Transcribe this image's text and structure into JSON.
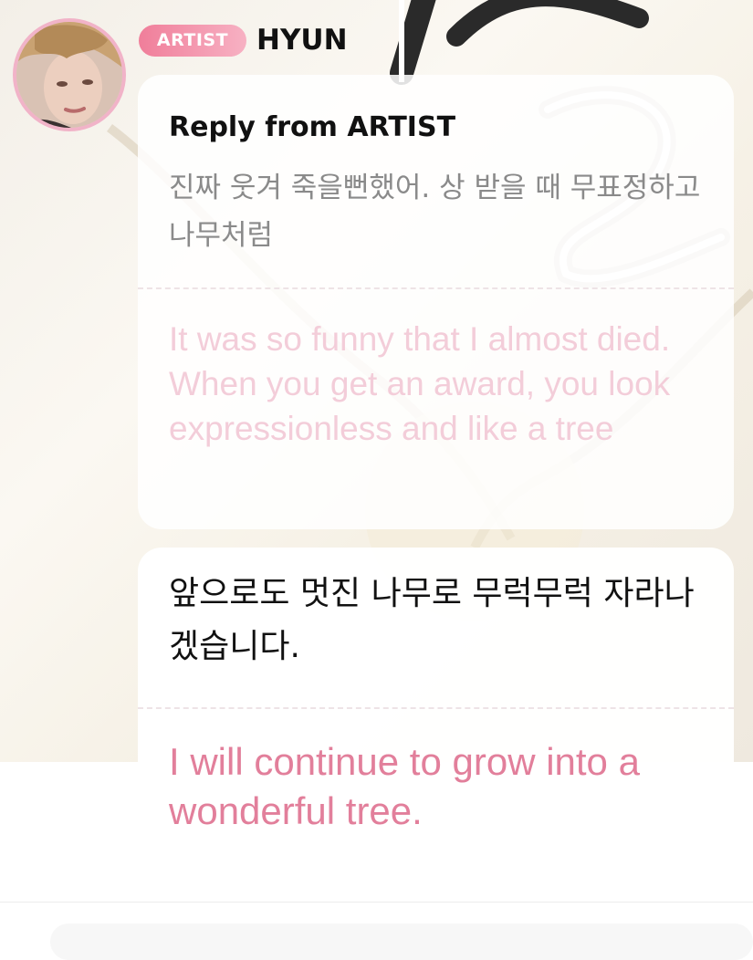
{
  "post": {
    "badge_label": "ARTIST",
    "artist_name": "HYUN"
  },
  "reply": {
    "header": "Reply from ARTIST",
    "original_ko": "진짜 웃겨 죽을뻔했어. 상 받을 때 무표정하고 나무처럼",
    "translation_en": "It was so funny that I almost died. When you get an award, you look expressionless and like a tree"
  },
  "message": {
    "text_ko": "앞으로도 멋진 나무로 무럭무럭 자라나겠습니다.",
    "translation_en": "I will continue to grow into a wonderful tree."
  },
  "icons": {
    "avatar": "artist-profile-photo"
  },
  "colors": {
    "accent_pink": "#e27f9b",
    "badge_gradient_start": "#f07e9a",
    "badge_gradient_end": "#f7b1c3",
    "faded_translation": "#f3cdd9",
    "avatar_ring": "#f1b3c8"
  }
}
